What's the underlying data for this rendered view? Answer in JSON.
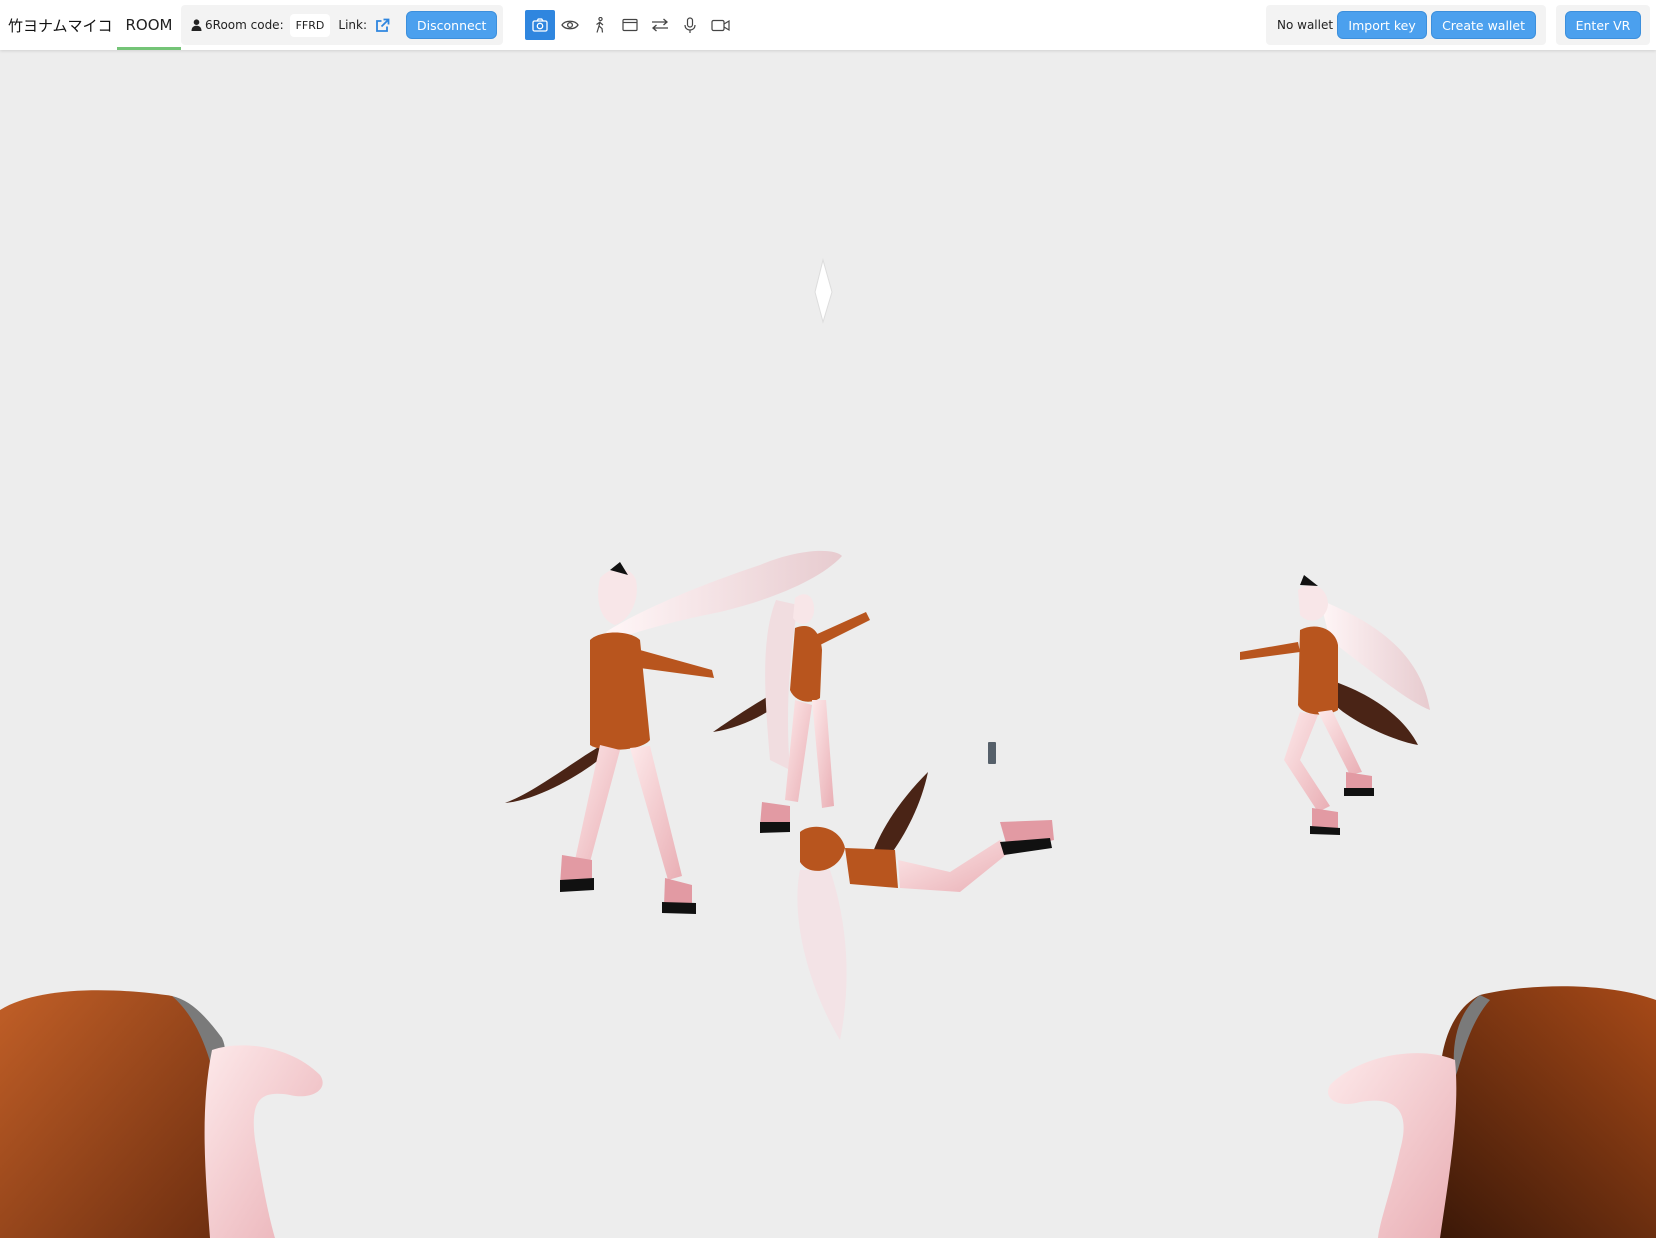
{
  "app": {
    "title": "竹ヨナムマイコ",
    "tab_room": "ROOM"
  },
  "room": {
    "user_count": "6",
    "room_code_label": "Room code:",
    "room_code": "FFRD",
    "link_label": "Link:",
    "disconnect_label": "Disconnect"
  },
  "toolbar": {
    "tools": [
      "camera-icon",
      "eye-icon",
      "walk-icon",
      "window-icon",
      "swap-arrows-icon",
      "microphone-icon",
      "video-camera-icon"
    ],
    "active_tool": "camera-icon"
  },
  "wallet": {
    "status": "No wallet",
    "import_label": "Import key",
    "create_label": "Create wallet"
  },
  "vr": {
    "enter_label": "Enter VR"
  },
  "colors": {
    "accent_blue": "#4ba0ee",
    "active_tool_blue": "#2f86df",
    "tab_underline": "#74c477",
    "scene_background": "#ededed",
    "hoodie_orange": "#b8551e",
    "tail_brown": "#4a2416",
    "hair_white": "#f3e3e6"
  }
}
